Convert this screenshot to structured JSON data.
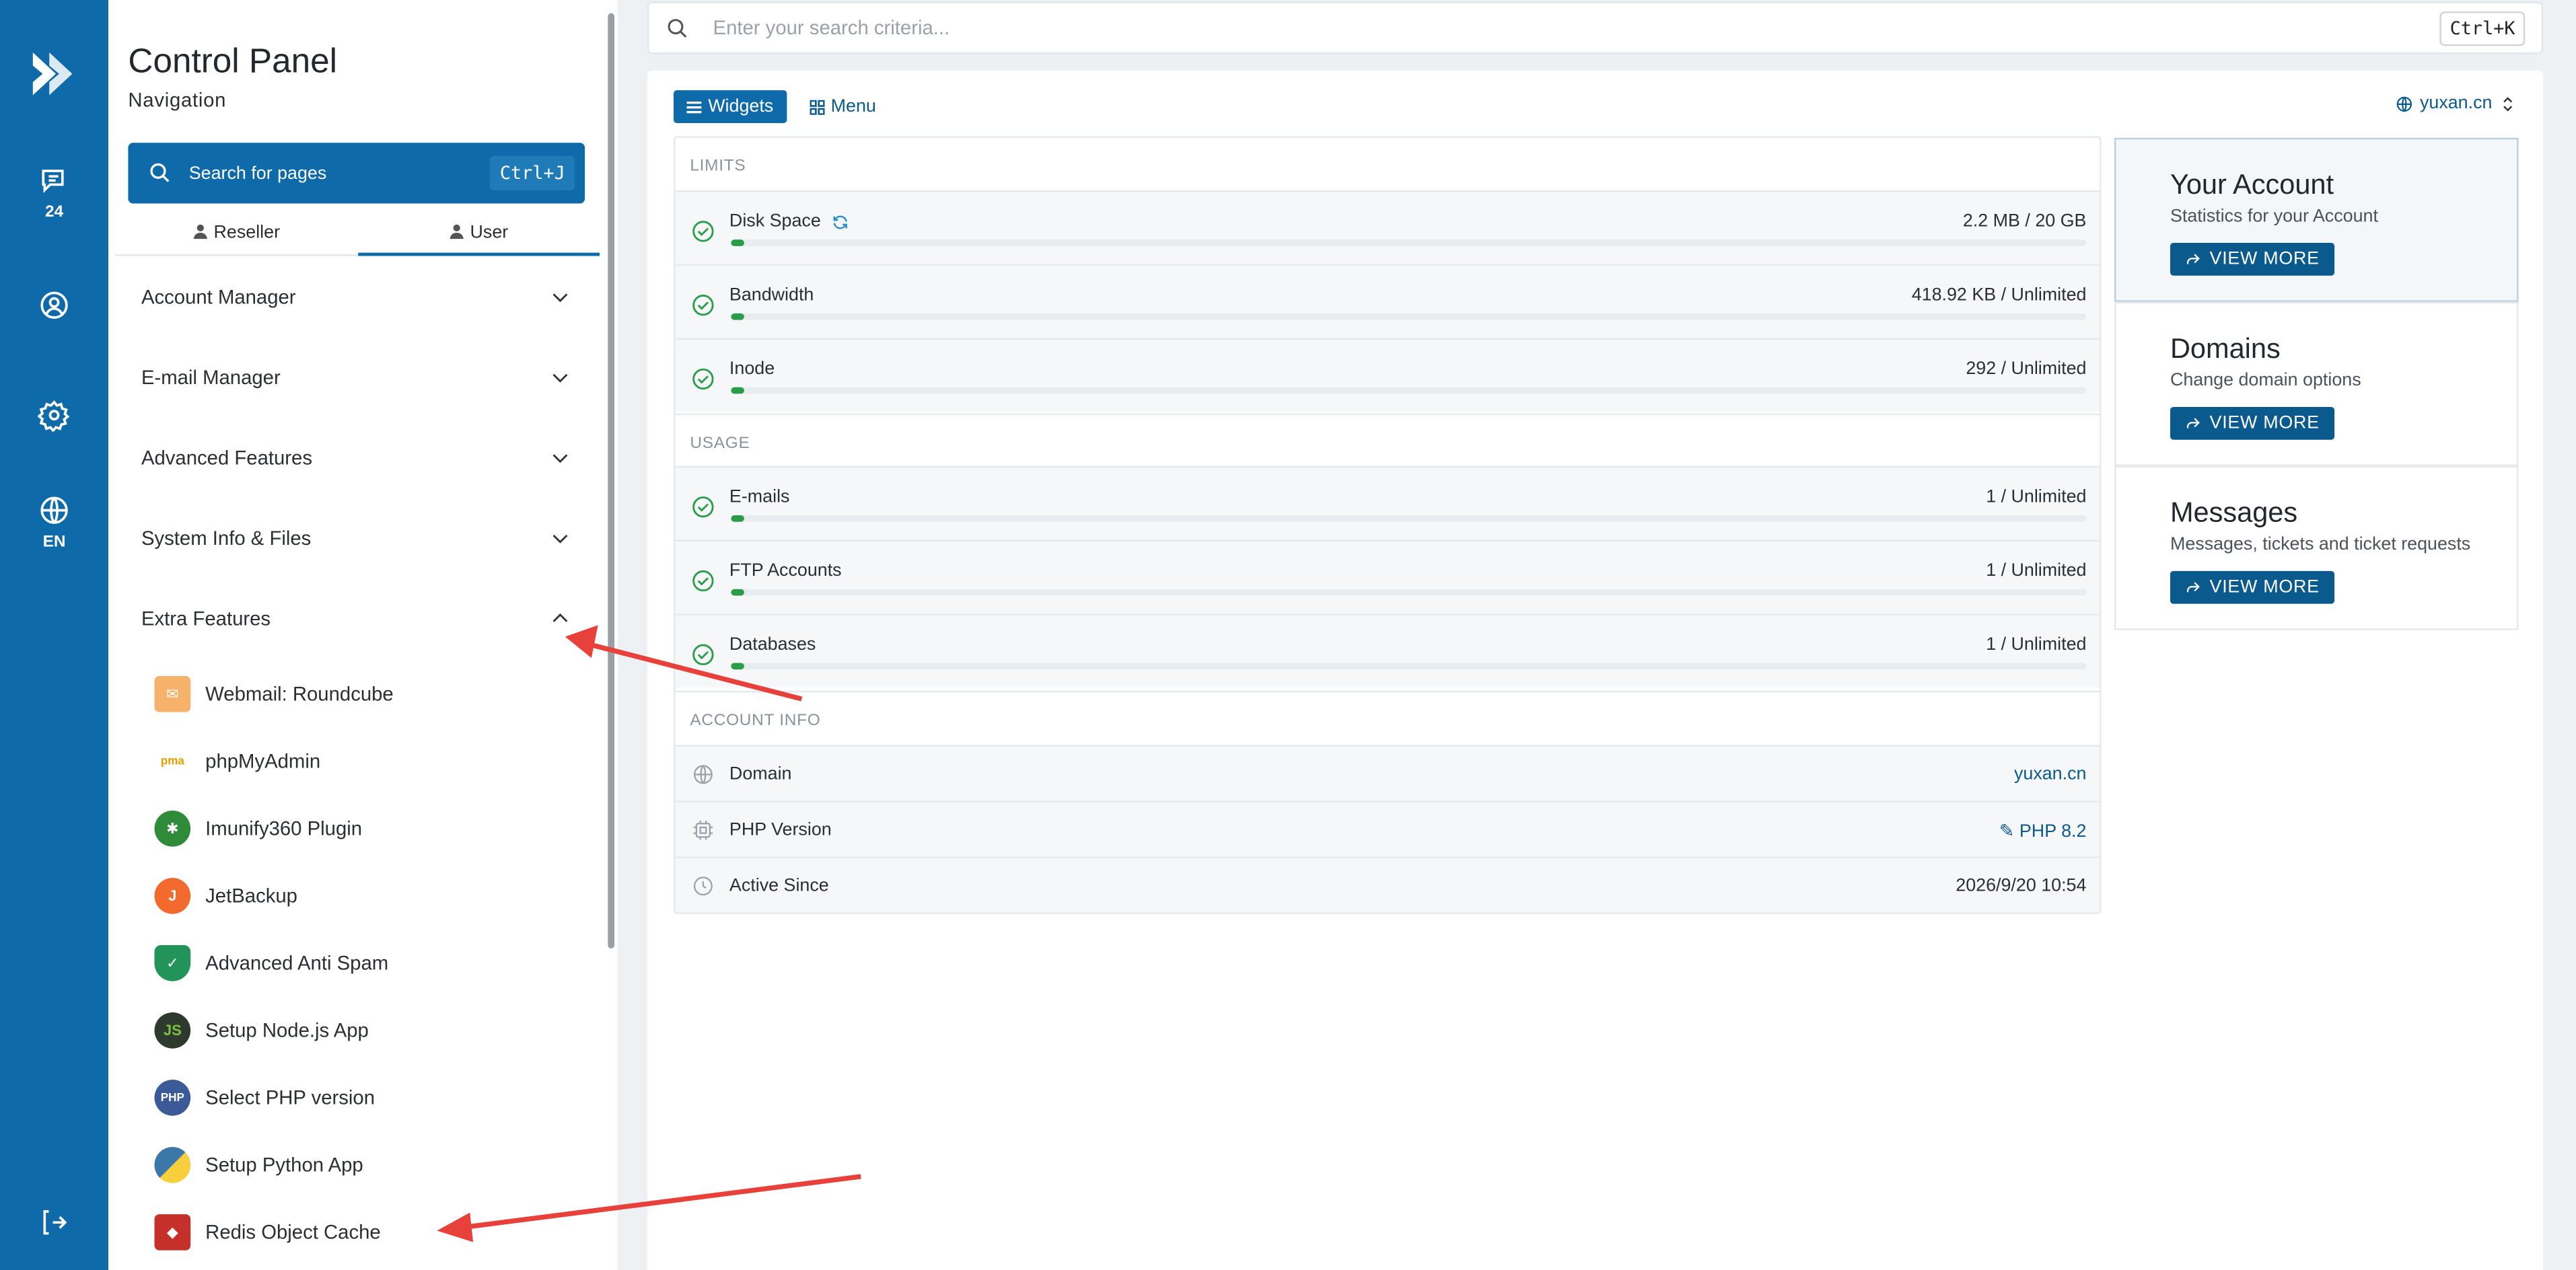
{
  "rail": {
    "messages_badge": "24",
    "language": "EN"
  },
  "sidebar": {
    "title": "Control Panel",
    "subtitle": "Navigation",
    "search_label": "Search for pages",
    "search_kbd": "Ctrl+J",
    "tabs": [
      {
        "label": "Reseller"
      },
      {
        "label": "User"
      }
    ],
    "sections": [
      {
        "label": "Account Manager"
      },
      {
        "label": "E-mail Manager"
      },
      {
        "label": "Advanced Features"
      },
      {
        "label": "System Info & Files"
      },
      {
        "label": "Extra Features"
      }
    ],
    "extra_items": [
      {
        "label": "Webmail: Roundcube"
      },
      {
        "label": "phpMyAdmin"
      },
      {
        "label": "Imunify360 Plugin"
      },
      {
        "label": "JetBackup"
      },
      {
        "label": "Advanced Anti Spam"
      },
      {
        "label": "Setup Node.js App"
      },
      {
        "label": "Select PHP version"
      },
      {
        "label": "Setup Python App"
      },
      {
        "label": "Redis Object Cache"
      }
    ]
  },
  "topbar": {
    "placeholder": "Enter your search criteria...",
    "kbd": "Ctrl+K"
  },
  "main": {
    "widgets_label": "Widgets",
    "menu_label": "Menu",
    "domain": "yuxan.cn",
    "limits_title": "LIMITS",
    "usage_title": "USAGE",
    "account_title": "ACCOUNT INFO",
    "limits": [
      {
        "name": "Disk Space",
        "value": "2.2 MB / 20 GB",
        "fill": 0.01
      },
      {
        "name": "Bandwidth",
        "value": "418.92 KB / Unlimited",
        "fill": 0.01
      },
      {
        "name": "Inode",
        "value": "292 / Unlimited",
        "fill": 0.01
      }
    ],
    "usage": [
      {
        "name": "E-mails",
        "value": "1 / Unlimited",
        "fill": 0.01
      },
      {
        "name": "FTP Accounts",
        "value": "1 / Unlimited",
        "fill": 0.01
      },
      {
        "name": "Databases",
        "value": "1 / Unlimited",
        "fill": 0.01
      }
    ],
    "account": [
      {
        "name": "Domain",
        "value": "yuxan.cn"
      },
      {
        "name": "PHP Version",
        "value": "PHP 8.2"
      },
      {
        "name": "Active Since",
        "value": "2026/9/20 10:54"
      }
    ]
  },
  "cards": [
    {
      "title": "Your Account",
      "desc": "Statistics for your Account",
      "button": "VIEW MORE"
    },
    {
      "title": "Domains",
      "desc": "Change domain options",
      "button": "VIEW MORE"
    },
    {
      "title": "Messages",
      "desc": "Messages, tickets and ticket requests",
      "button": "VIEW MORE"
    }
  ],
  "colors": {
    "brand": "#0e6aa8",
    "success": "#2a9d4a",
    "annotation": "#e8413c"
  }
}
